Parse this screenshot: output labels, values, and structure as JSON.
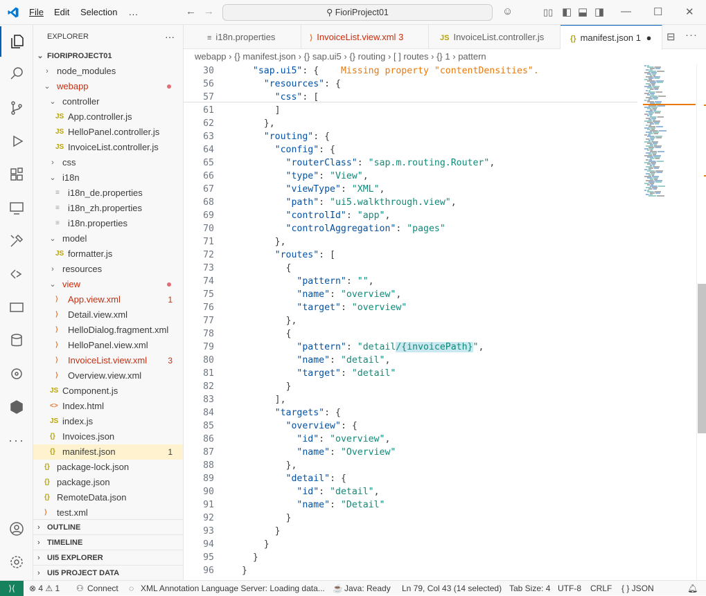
{
  "titlebar": {
    "menus": [
      "File",
      "Edit",
      "Selection"
    ],
    "more": "...",
    "search": "FioriProject01"
  },
  "sidebar": {
    "title": "EXPLORER",
    "more": "···",
    "root": "FIORIPROJECT01",
    "tree": [
      {
        "name": "node_modules",
        "kind": "folder",
        "open": false,
        "indent": 0
      },
      {
        "name": "webapp",
        "kind": "folder",
        "open": true,
        "indent": 0,
        "status": "error-dot"
      },
      {
        "name": "controller",
        "kind": "folder",
        "open": true,
        "indent": 1
      },
      {
        "name": "App.controller.js",
        "kind": "js",
        "indent": 2
      },
      {
        "name": "HelloPanel.controller.js",
        "kind": "js",
        "indent": 2
      },
      {
        "name": "InvoiceList.controller.js",
        "kind": "js",
        "indent": 2
      },
      {
        "name": "css",
        "kind": "folder",
        "open": false,
        "indent": 1
      },
      {
        "name": "i18n",
        "kind": "folder",
        "open": true,
        "indent": 1
      },
      {
        "name": "i18n_de.properties",
        "kind": "prop",
        "indent": 2
      },
      {
        "name": "i18n_zh.properties",
        "kind": "prop",
        "indent": 2
      },
      {
        "name": "i18n.properties",
        "kind": "prop",
        "indent": 2
      },
      {
        "name": "model",
        "kind": "folder",
        "open": true,
        "indent": 1
      },
      {
        "name": "formatter.js",
        "kind": "js",
        "indent": 2
      },
      {
        "name": "resources",
        "kind": "folder",
        "open": false,
        "indent": 1
      },
      {
        "name": "view",
        "kind": "folder",
        "open": true,
        "indent": 1,
        "status": "error-dot"
      },
      {
        "name": "App.view.xml",
        "kind": "xml",
        "indent": 2,
        "badge": "1",
        "error": true
      },
      {
        "name": "Detail.view.xml",
        "kind": "xml",
        "indent": 2
      },
      {
        "name": "HelloDialog.fragment.xml",
        "kind": "xml",
        "indent": 2
      },
      {
        "name": "HelloPanel.view.xml",
        "kind": "xml",
        "indent": 2
      },
      {
        "name": "InvoiceList.view.xml",
        "kind": "xml",
        "indent": 2,
        "badge": "3",
        "error": true
      },
      {
        "name": "Overview.view.xml",
        "kind": "xml",
        "indent": 2
      },
      {
        "name": "Component.js",
        "kind": "js",
        "indent": 1
      },
      {
        "name": "Index.html",
        "kind": "html",
        "indent": 1
      },
      {
        "name": "index.js",
        "kind": "js",
        "indent": 1
      },
      {
        "name": "Invoices.json",
        "kind": "json",
        "indent": 1
      },
      {
        "name": "manifest.json",
        "kind": "json",
        "indent": 1,
        "badge": "1",
        "selected": true
      },
      {
        "name": "package-lock.json",
        "kind": "json",
        "indent": 0
      },
      {
        "name": "package.json",
        "kind": "json",
        "indent": 0
      },
      {
        "name": "RemoteData.json",
        "kind": "json",
        "indent": 0
      },
      {
        "name": "test.xml",
        "kind": "xml",
        "indent": 0
      }
    ],
    "sections": [
      "OUTLINE",
      "TIMELINE",
      "UI5 EXPLORER",
      "UI5 PROJECT DATA"
    ]
  },
  "tabs": [
    {
      "label": "i18n.properties",
      "icon": "≡",
      "badge": ""
    },
    {
      "label": "InvoiceList.view.xml",
      "icon": "xml",
      "badge": "3",
      "error": true
    },
    {
      "label": "InvoiceList.controller.js",
      "icon": "JS",
      "badge": ""
    },
    {
      "label": "manifest.json",
      "icon": "{}",
      "badge": "1",
      "active": true
    }
  ],
  "breadcrumbs": [
    "webapp",
    "{} manifest.json",
    "{} sap.ui5",
    "{} routing",
    "[ ] routes",
    "{} 1",
    "pattern"
  ],
  "editor": {
    "sticky": [
      {
        "n": "30",
        "html": "  <span class='key'>\"sap.ui5\"</span>: {    <span class='warn'>Missing property \"contentDensities\".</span>"
      },
      {
        "n": "56",
        "html": "    <span class='key'>\"resources\"</span>: {"
      },
      {
        "n": "57",
        "html": "      <span class='key'>\"css\"</span>: ["
      }
    ],
    "lines": [
      {
        "n": "61",
        "html": "      ]"
      },
      {
        "n": "62",
        "html": "    },"
      },
      {
        "n": "63",
        "html": "    <span class='key'>\"routing\"</span>: {"
      },
      {
        "n": "64",
        "html": "      <span class='key'>\"config\"</span>: {"
      },
      {
        "n": "65",
        "html": "        <span class='key'>\"routerClass\"</span>: <span class='val'>\"sap.m.routing.Router\"</span>,"
      },
      {
        "n": "66",
        "html": "        <span class='key'>\"type\"</span>: <span class='val'>\"View\"</span>,"
      },
      {
        "n": "67",
        "html": "        <span class='key'>\"viewType\"</span>: <span class='val'>\"XML\"</span>,"
      },
      {
        "n": "68",
        "html": "        <span class='key'>\"path\"</span>: <span class='val'>\"ui5.walkthrough.view\"</span>,"
      },
      {
        "n": "69",
        "html": "        <span class='key'>\"controlId\"</span>: <span class='val'>\"app\"</span>,"
      },
      {
        "n": "70",
        "html": "        <span class='key'>\"controlAggregation\"</span>: <span class='val'>\"pages\"</span>"
      },
      {
        "n": "71",
        "html": "      },"
      },
      {
        "n": "72",
        "html": "      <span class='key'>\"routes\"</span>: ["
      },
      {
        "n": "73",
        "html": "        {"
      },
      {
        "n": "74",
        "html": "          <span class='key'>\"pattern\"</span>: <span class='val'>\"\"</span>,"
      },
      {
        "n": "75",
        "html": "          <span class='key'>\"name\"</span>: <span class='val'>\"overview\"</span>,"
      },
      {
        "n": "76",
        "html": "          <span class='key'>\"target\"</span>: <span class='val'>\"overview\"</span>"
      },
      {
        "n": "77",
        "html": "        },"
      },
      {
        "n": "78",
        "html": "        {"
      },
      {
        "n": "79",
        "html": "          <span class='key'>\"pattern\"</span>: <span class='val'>\"detail<span class='hl'>/{invoicePath}</span>\"</span>,"
      },
      {
        "n": "80",
        "html": "          <span class='key'>\"name\"</span>: <span class='val'>\"detail\"</span>,"
      },
      {
        "n": "81",
        "html": "          <span class='key'>\"target\"</span>: <span class='val'>\"detail\"</span>"
      },
      {
        "n": "82",
        "html": "        }"
      },
      {
        "n": "83",
        "html": "      ],"
      },
      {
        "n": "84",
        "html": "      <span class='key'>\"targets\"</span>: {"
      },
      {
        "n": "85",
        "html": "        <span class='key'>\"overview\"</span>: {"
      },
      {
        "n": "86",
        "html": "          <span class='key'>\"id\"</span>: <span class='val'>\"overview\"</span>,"
      },
      {
        "n": "87",
        "html": "          <span class='key'>\"name\"</span>: <span class='val'>\"Overview\"</span>"
      },
      {
        "n": "88",
        "html": "        },"
      },
      {
        "n": "89",
        "html": "        <span class='key'>\"detail\"</span>: {"
      },
      {
        "n": "90",
        "html": "          <span class='key'>\"id\"</span>: <span class='val'>\"detail\"</span>,"
      },
      {
        "n": "91",
        "html": "          <span class='key'>\"name\"</span>: <span class='val'>\"Detail\"</span>"
      },
      {
        "n": "92",
        "html": "        }"
      },
      {
        "n": "93",
        "html": "      }"
      },
      {
        "n": "94",
        "html": "    }"
      },
      {
        "n": "95",
        "html": "  }"
      },
      {
        "n": "96",
        "html": "}"
      }
    ]
  },
  "status": {
    "problems": "⊗ 4 ⚠ 1",
    "connect": "Connect",
    "xml_server": "XML Annotation Language Server: Loading data...",
    "java": "Java: Ready",
    "position": "Ln 79, Col 43 (14 selected)",
    "tabsize": "Tab Size: 4",
    "encoding": "UTF-8",
    "eol": "CRLF",
    "language": "{ } JSON"
  },
  "colors": {
    "accent": "#005fb8",
    "error": "#c72e0f",
    "remote": "#16825d",
    "selected_file": "#fff3cf"
  }
}
